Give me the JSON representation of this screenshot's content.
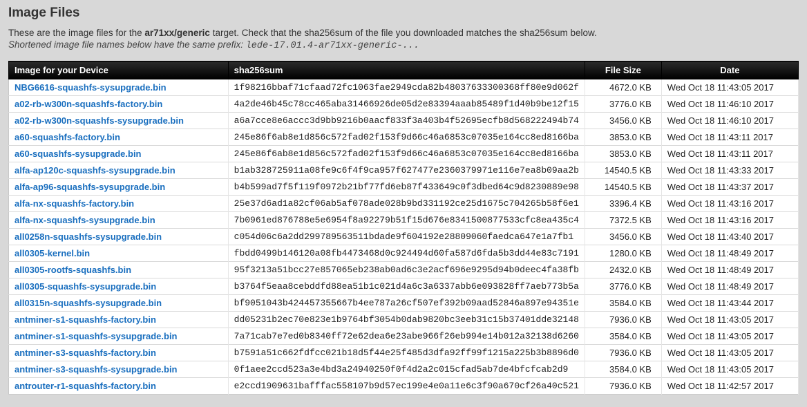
{
  "heading": "Image Files",
  "intro_pre": "These are the image files for the ",
  "intro_target": "ar71xx/generic",
  "intro_post": " target. Check that the sha256sum of the file you downloaded matches the sha256sum below.",
  "sub_pre": "Shortened image file names below have the same prefix: ",
  "sub_prefix": "lede-17.01.4-ar71xx-generic-...",
  "columns": {
    "name": "Image for your Device",
    "sha": "sha256sum",
    "size": "File Size",
    "date": "Date"
  },
  "rows": [
    {
      "name": "NBG6616-squashfs-sysupgrade.bin",
      "sha": "1f98216bbaf71cfaad72fc1063fae2949cda82b48037633300368ff80e9d062f",
      "size": "4672.0 KB",
      "date": "Wed Oct 18 11:43:05 2017"
    },
    {
      "name": "a02-rb-w300n-squashfs-factory.bin",
      "sha": "4a2de46b45c78cc465aba31466926de05d2e83394aaab85489f1d40b9be12f15",
      "size": "3776.0 KB",
      "date": "Wed Oct 18 11:46:10 2017"
    },
    {
      "name": "a02-rb-w300n-squashfs-sysupgrade.bin",
      "sha": "a6a7cce8e6accc3d9bb9216b0aacf833f3a403b4f52695ecfb8d568222494b74",
      "size": "3456.0 KB",
      "date": "Wed Oct 18 11:46:10 2017"
    },
    {
      "name": "a60-squashfs-factory.bin",
      "sha": "245e86f6ab8e1d856c572fad02f153f9d66c46a6853c07035e164cc8ed8166ba",
      "size": "3853.0 KB",
      "date": "Wed Oct 18 11:43:11 2017"
    },
    {
      "name": "a60-squashfs-sysupgrade.bin",
      "sha": "245e86f6ab8e1d856c572fad02f153f9d66c46a6853c07035e164cc8ed8166ba",
      "size": "3853.0 KB",
      "date": "Wed Oct 18 11:43:11 2017"
    },
    {
      "name": "alfa-ap120c-squashfs-sysupgrade.bin",
      "sha": "b1ab328725911a08fe9c6f4f9ca957f627477e2360379971e116e7ea8b09aa2b",
      "size": "14540.5 KB",
      "date": "Wed Oct 18 11:43:33 2017"
    },
    {
      "name": "alfa-ap96-squashfs-sysupgrade.bin",
      "sha": "b4b599ad7f5f119f0972b21bf77fd6eb87f433649c0f3dbed64c9d8230889e98",
      "size": "14540.5 KB",
      "date": "Wed Oct 18 11:43:37 2017"
    },
    {
      "name": "alfa-nx-squashfs-factory.bin",
      "sha": "25e37d6ad1a82cf06ab5af078ade028b9bd331192ce25d1675c704265b58f6e1",
      "size": "3396.4 KB",
      "date": "Wed Oct 18 11:43:16 2017"
    },
    {
      "name": "alfa-nx-squashfs-sysupgrade.bin",
      "sha": "7b0961ed876788e5e6954f8a92279b51f15d676e8341500877533cfc8ea435c4",
      "size": "7372.5 KB",
      "date": "Wed Oct 18 11:43:16 2017"
    },
    {
      "name": "all0258n-squashfs-sysupgrade.bin",
      "sha": "c054d06c6a2dd299789563511bdade9f604192e28809060faedca647e1a7fb1",
      "size": "3456.0 KB",
      "date": "Wed Oct 18 11:43:40 2017"
    },
    {
      "name": "all0305-kernel.bin",
      "sha": "fbdd0499b146120a08fb4473468d0c924494d60fa587d6fda5b3dd44e83c7191",
      "size": "1280.0 KB",
      "date": "Wed Oct 18 11:48:49 2017"
    },
    {
      "name": "all0305-rootfs-squashfs.bin",
      "sha": "95f3213a51bcc27e857065eb238ab0ad6c3e2acf696e9295d94b0deec4fa38fb",
      "size": "2432.0 KB",
      "date": "Wed Oct 18 11:48:49 2017"
    },
    {
      "name": "all0305-squashfs-sysupgrade.bin",
      "sha": "b3764f5eaa8cebddfd88ea51b1c021d4a6c3a6337abb6e093828ff7aeb773b5a",
      "size": "3776.0 KB",
      "date": "Wed Oct 18 11:48:49 2017"
    },
    {
      "name": "all0315n-squashfs-sysupgrade.bin",
      "sha": "bf9051043b424457355667b4ee787a26cf507ef392b09aad52846a897e94351e",
      "size": "3584.0 KB",
      "date": "Wed Oct 18 11:43:44 2017"
    },
    {
      "name": "antminer-s1-squashfs-factory.bin",
      "sha": "dd05231b2ec70e823e1b9764bf3054b0dab9820bc3eeb31c15b37401dde32148",
      "size": "7936.0 KB",
      "date": "Wed Oct 18 11:43:05 2017"
    },
    {
      "name": "antminer-s1-squashfs-sysupgrade.bin",
      "sha": "7a71cab7e7ed0b8340ff72e62dea6e23abe966f26eb994e14b012a32138d6260",
      "size": "3584.0 KB",
      "date": "Wed Oct 18 11:43:05 2017"
    },
    {
      "name": "antminer-s3-squashfs-factory.bin",
      "sha": "b7591a51c662fdfcc021b18d5f44e25f485d3dfa92ff99f1215a225b3b8896d0",
      "size": "7936.0 KB",
      "date": "Wed Oct 18 11:43:05 2017"
    },
    {
      "name": "antminer-s3-squashfs-sysupgrade.bin",
      "sha": "0f1aee2ccd523a3e4bd3a24940250f0f4d2a2c015cfad5ab7de4bfcfcab2d9",
      "size": "3584.0 KB",
      "date": "Wed Oct 18 11:43:05 2017"
    },
    {
      "name": "antrouter-r1-squashfs-factory.bin",
      "sha": "e2ccd1909631bafffac558107b9d57ec199e4e0a11e6c3f90a670cf26a40c521",
      "size": "7936.0 KB",
      "date": "Wed Oct 18 11:42:57 2017"
    }
  ]
}
